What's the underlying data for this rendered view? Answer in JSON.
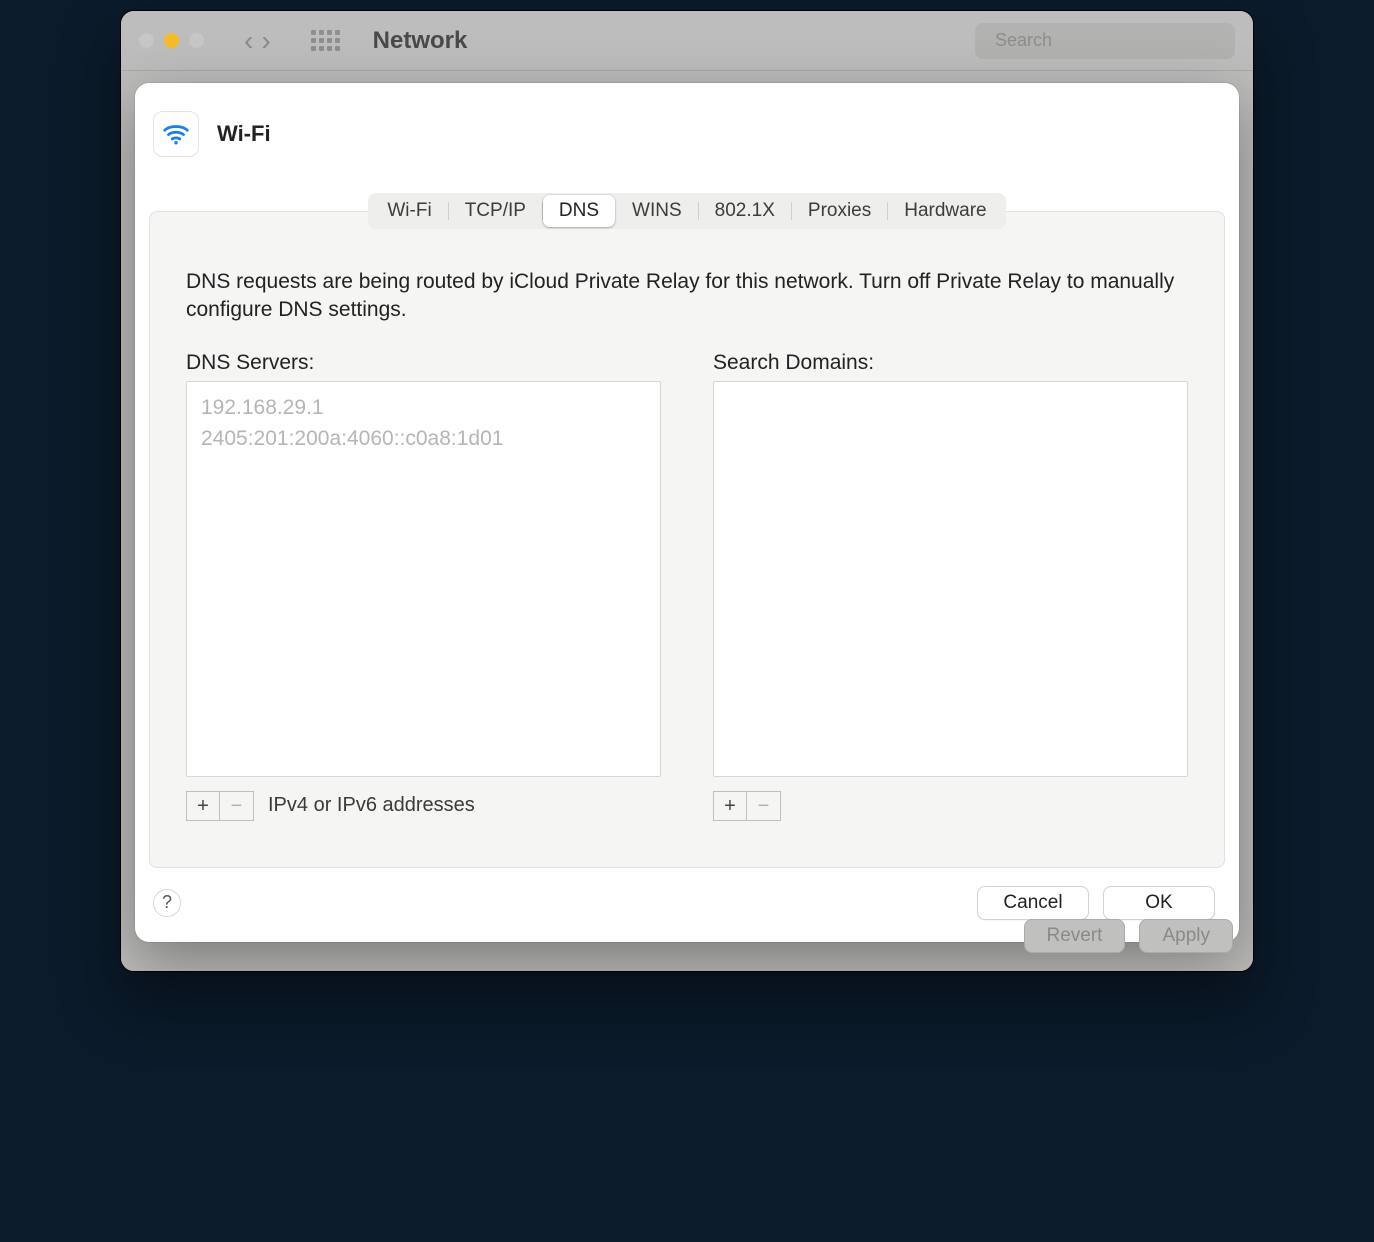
{
  "window": {
    "title": "Network",
    "search_placeholder": "Search",
    "footer": {
      "revert": "Revert",
      "apply": "Apply"
    }
  },
  "sheet": {
    "header": {
      "title": "Wi-Fi"
    },
    "tabs": [
      "Wi-Fi",
      "TCP/IP",
      "DNS",
      "WINS",
      "802.1X",
      "Proxies",
      "Hardware"
    ],
    "active_tab": "DNS",
    "notice": "DNS requests are being routed by iCloud Private Relay for this network. Turn off Private Relay to manually configure DNS settings.",
    "dns": {
      "label": "DNS Servers:",
      "items": [
        "192.168.29.1",
        "2405:201:200a:4060::c0a8:1d01"
      ],
      "hint": "IPv4 or IPv6 addresses"
    },
    "search_domains": {
      "label": "Search Domains:",
      "items": []
    },
    "buttons": {
      "cancel": "Cancel",
      "ok": "OK"
    },
    "help_symbol": "?"
  }
}
